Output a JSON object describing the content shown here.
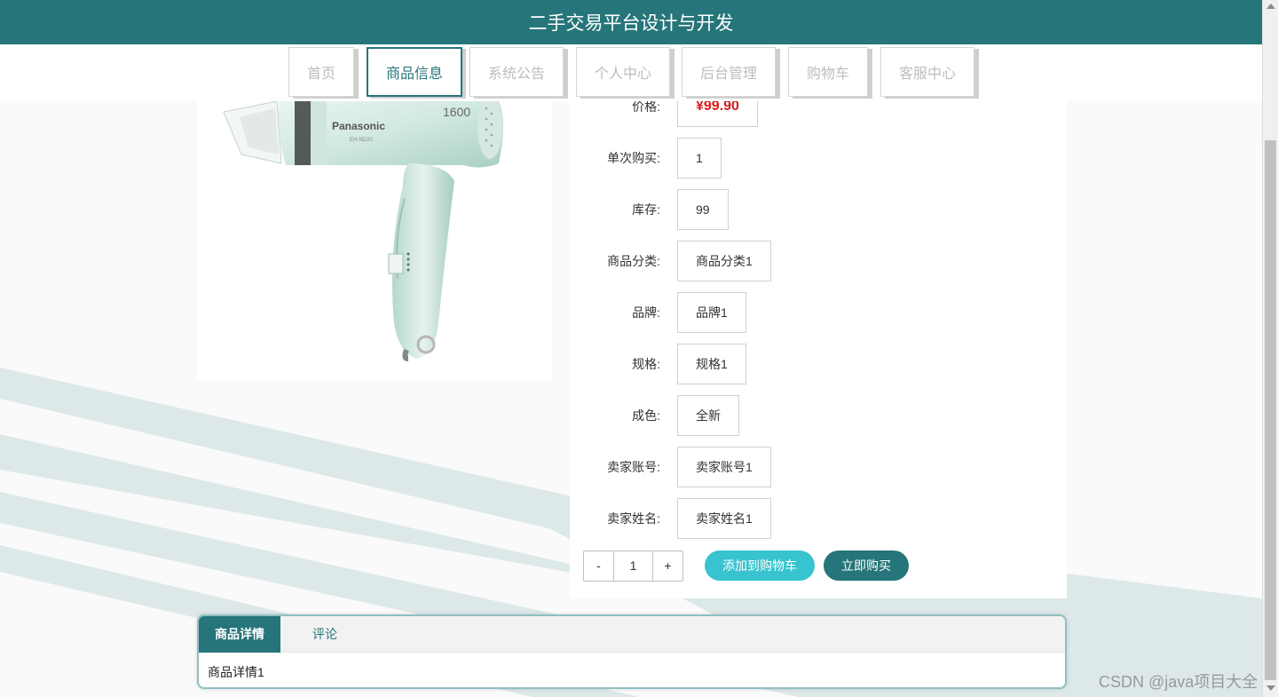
{
  "header": {
    "title": "二手交易平台设计与开发"
  },
  "nav": [
    {
      "label": "首页",
      "active": false
    },
    {
      "label": "商品信息",
      "active": true
    },
    {
      "label": "系统公告",
      "active": false
    },
    {
      "label": "个人中心",
      "active": false
    },
    {
      "label": "后台管理",
      "active": false
    },
    {
      "label": "购物车",
      "active": false
    },
    {
      "label": "客服中心",
      "active": false
    }
  ],
  "product_image": {
    "brand": "Panasonic",
    "model_text": "1600",
    "sub_text": "EH-ND20"
  },
  "details": {
    "price": {
      "label": "价格:",
      "value": "¥99.90"
    },
    "single_purchase": {
      "label": "单次购买:",
      "value": "1"
    },
    "stock": {
      "label": "库存:",
      "value": "99"
    },
    "category": {
      "label": "商品分类:",
      "value": "商品分类1"
    },
    "brand": {
      "label": "品牌:",
      "value": "品牌1"
    },
    "spec": {
      "label": "规格:",
      "value": "规格1"
    },
    "condition": {
      "label": "成色:",
      "value": "全新"
    },
    "seller_account": {
      "label": "卖家账号:",
      "value": "卖家账号1"
    },
    "seller_name": {
      "label": "卖家姓名:",
      "value": "卖家姓名1"
    }
  },
  "quantity": {
    "minus": "-",
    "value": "1",
    "plus": "+"
  },
  "actions": {
    "add_to_cart": "添加到购物车",
    "buy_now": "立即购买"
  },
  "tabs": [
    {
      "label": "商品详情",
      "active": true
    },
    {
      "label": "评论",
      "active": false
    }
  ],
  "tab_content": "商品详情1",
  "watermark": "CSDN @java项目大全",
  "colors": {
    "primary": "#26757a",
    "accent": "#37c3cf",
    "price": "#d71a1a"
  }
}
